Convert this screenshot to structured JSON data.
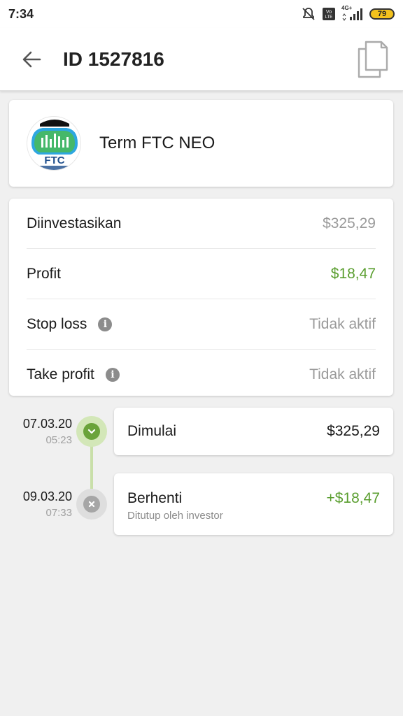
{
  "status_bar": {
    "time": "7:34",
    "network_label": "4G+",
    "battery": "79",
    "icons": [
      "mute-icon",
      "volte-icon",
      "signal-icon",
      "battery-icon"
    ]
  },
  "app_bar": {
    "title": "ID 1527816",
    "back_icon": "arrow-left-icon",
    "copy_icon": "copy-icon"
  },
  "strategy": {
    "name": "Term FTC NEO",
    "logo_text": "FTC"
  },
  "details": [
    {
      "label": "Diinvestasikan",
      "value": "$325,29",
      "value_color": "#9a9a9a",
      "info": false
    },
    {
      "label": "Profit",
      "value": "$18,47",
      "value_color": "#5a9e2f",
      "info": false
    },
    {
      "label": "Stop loss",
      "value": "Tidak aktif",
      "value_color": "#9a9a9a",
      "info": true
    },
    {
      "label": "Take profit",
      "value": "Tidak aktif",
      "value_color": "#9a9a9a",
      "info": true
    }
  ],
  "timeline": [
    {
      "date": "07.03.20",
      "time": "05:23",
      "title": "Dimulai",
      "amount": "$325,29",
      "subtitle": "",
      "state": "started"
    },
    {
      "date": "09.03.20",
      "time": "07:33",
      "title": "Berhenti",
      "amount": "+$18,47",
      "subtitle": "Ditutup oleh investor",
      "state": "stopped"
    }
  ],
  "colors": {
    "accent_green": "#5a9e2f",
    "node_green": "#6aa33a",
    "background": "#f0f0f0"
  }
}
